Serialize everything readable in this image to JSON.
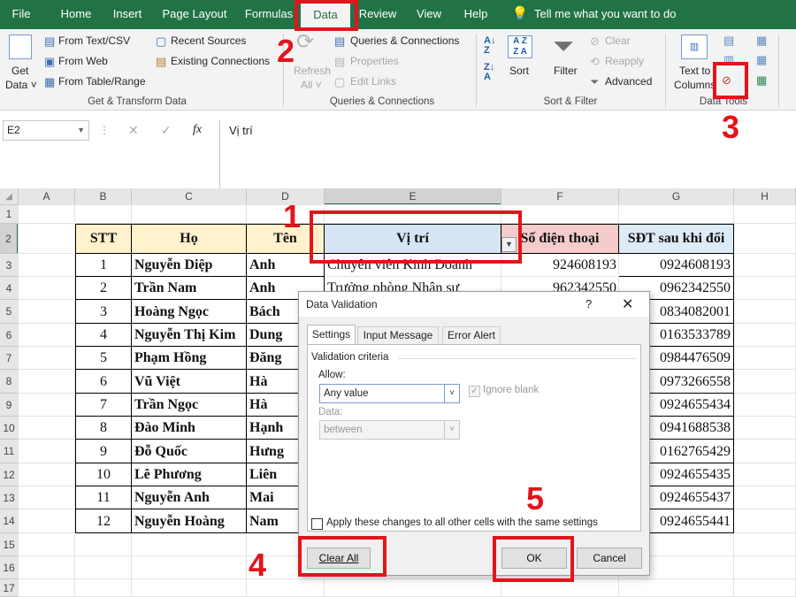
{
  "tabs": [
    "File",
    "Home",
    "Insert",
    "Page Layout",
    "Formulas",
    "Data",
    "Review",
    "View",
    "Help"
  ],
  "tell_me": "Tell me what you want to do",
  "ribbon": {
    "get_data": [
      "Get",
      "Data"
    ],
    "from_text": "From Text/CSV",
    "from_web": "From Web",
    "from_table": "From Table/Range",
    "recent_sources": "Recent Sources",
    "existing_conn": "Existing Connections",
    "group1": "Get & Transform Data",
    "refresh": [
      "Refresh",
      "All"
    ],
    "queries_conn": "Queries & Connections",
    "properties": "Properties",
    "edit_links": "Edit Links",
    "group2": "Queries & Connections",
    "sort": "Sort",
    "filter": "Filter",
    "clear": "Clear",
    "reapply": "Reapply",
    "advanced": "Advanced",
    "group3": "Sort & Filter",
    "text_to": [
      "Text to",
      "Columns"
    ],
    "group4": "Data Tools"
  },
  "formula_bar": {
    "name_box": "E2",
    "fx": "fx",
    "value": "Vị trí"
  },
  "columns": [
    "A",
    "B",
    "C",
    "D",
    "E",
    "F",
    "G",
    "H"
  ],
  "rows": [
    "1",
    "2",
    "3",
    "4",
    "5",
    "6",
    "7",
    "8",
    "9",
    "10",
    "11",
    "12",
    "13",
    "14",
    "15",
    "16",
    "17"
  ],
  "table": {
    "headers": [
      "STT",
      "Họ",
      "Tên",
      "Vị trí",
      "Số điện thoại",
      "SĐT sau khi đổi"
    ],
    "data": [
      [
        "1",
        "Nguyễn Diệp",
        "Anh",
        "Chuyên viên Kinh Doanh",
        "924608193",
        "0924608193"
      ],
      [
        "2",
        "Trần Nam",
        "Anh",
        "Trưởng phòng Nhân sự",
        "962342550",
        "0962342550"
      ],
      [
        "3",
        "Hoàng Ngọc",
        "Bách",
        "",
        "",
        "0834082001"
      ],
      [
        "4",
        "Nguyễn Thị Kim",
        "Dung",
        "",
        "",
        "0163533789"
      ],
      [
        "5",
        "Phạm Hồng",
        "Đăng",
        "",
        "",
        "0984476509"
      ],
      [
        "6",
        "Vũ Việt",
        "Hà",
        "",
        "",
        "0973266558"
      ],
      [
        "7",
        "Trần Ngọc",
        "Hà",
        "",
        "",
        "0924655434"
      ],
      [
        "8",
        "Đào Minh",
        "Hạnh",
        "",
        "",
        "0941688538"
      ],
      [
        "9",
        "Đỗ Quốc",
        "Hưng",
        "",
        "",
        "0162765429"
      ],
      [
        "10",
        "Lê Phương",
        "Liên",
        "",
        "",
        "0924655435"
      ],
      [
        "11",
        "Nguyễn Anh",
        "Mai",
        "",
        "",
        "0924655437"
      ],
      [
        "12",
        "Nguyễn Hoàng",
        "Nam",
        "",
        "",
        "0924655441"
      ]
    ]
  },
  "dialog": {
    "title": "Data Validation",
    "help": "?",
    "close": "✕",
    "tabs": [
      "Settings",
      "Input Message",
      "Error Alert"
    ],
    "criteria": "Validation criteria",
    "allow_label": "Allow:",
    "allow_value": "Any value",
    "ignore_blank": "Ignore blank",
    "data_label": "Data:",
    "data_value": "between",
    "apply_all": "Apply these changes to all other cells with the same settings",
    "clear_all": "Clear All",
    "ok": "OK",
    "cancel": "Cancel"
  },
  "annotations": [
    "1",
    "2",
    "3",
    "4",
    "5"
  ],
  "colors": {
    "excel_green": "#217346",
    "header_yellow": "#fff2cc",
    "header_blue": "#ddebf7",
    "header_pink": "#f4cccc",
    "annotation_red": "#e3141b"
  }
}
